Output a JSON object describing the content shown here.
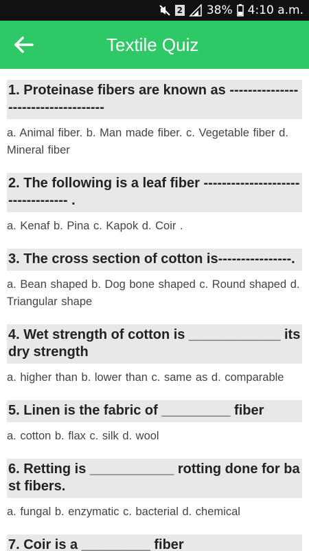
{
  "status_bar": {
    "battery": "38%",
    "time": "4:10 a.m.",
    "sim_label": "2"
  },
  "app_bar": {
    "title": "Textile Quiz",
    "back_icon": "arrow-left-icon"
  },
  "questions": [
    {
      "text": "1. Proteinase fibers are known as ------------------------------------",
      "options": "a. Animal fiber.   b. Man made fiber.   c. Vegetable fiber   d. Mineral fiber"
    },
    {
      "text": "2. The following is a leaf fiber ---------------------------------- .",
      "options": "a. Kenaf   b. Pina   c. Kapok   d. Coir ."
    },
    {
      "text": "3. The cross section of cotton is----------------.",
      "options": "a. Bean shaped   b. Dog bone shaped   c. Round shaped   d. Triangular shape"
    },
    {
      "text": "4. Wet strength of cotton is ____________ its dry strength",
      "options": "a. higher than   b. lower than   c. same as   d. comparable"
    },
    {
      "text": "5. Linen is the fabric of _________ fiber",
      "options": "a. cotton   b. flax   c. silk   d. wool"
    },
    {
      "text": "6. Retting is ___________ rotting done for bast fibers.",
      "options": "a. fungal   b. enzymatic   c. bacterial   d. chemical"
    },
    {
      "text": "7. Coir is a _________ fiber",
      "options": ""
    }
  ]
}
